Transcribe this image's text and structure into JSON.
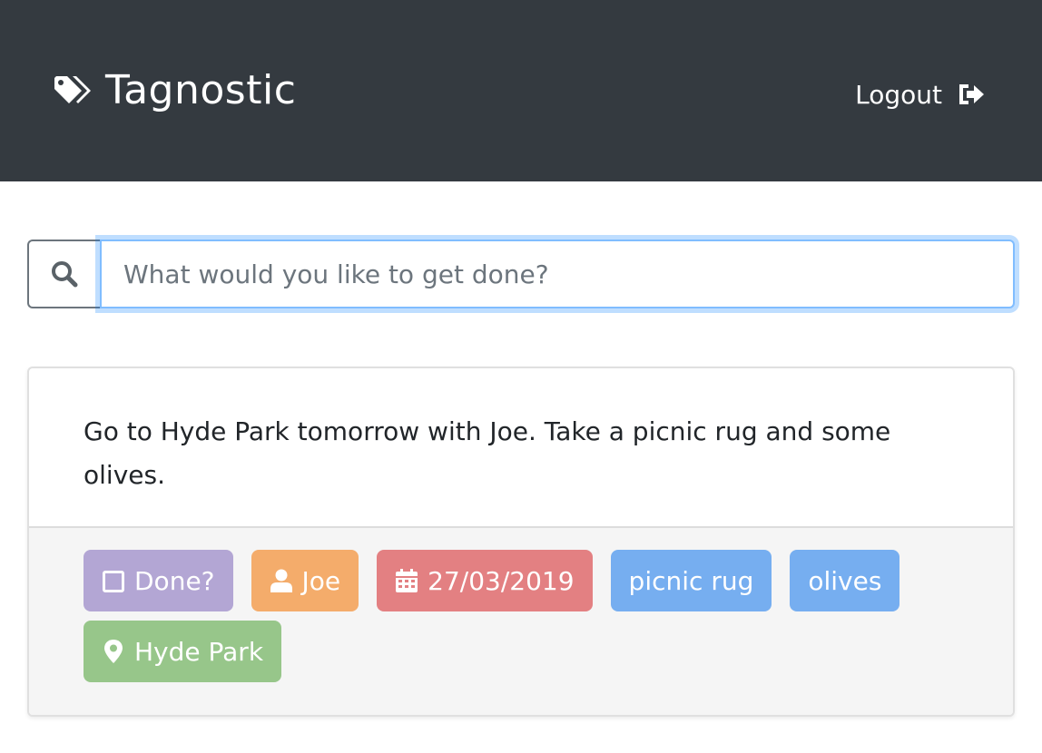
{
  "header": {
    "brand": "Tagnostic",
    "logout_label": "Logout",
    "background_color": "#343a40"
  },
  "search": {
    "placeholder": "What would you like to get done?",
    "value": ""
  },
  "task": {
    "text": "Go to Hyde Park tomorrow with Joe. Take a picnic rug and some olives.",
    "tags": {
      "done": {
        "label": "Done?",
        "icon": "checkbox-icon",
        "color": "#b3a6d4"
      },
      "person": {
        "label": "Joe",
        "icon": "user-icon",
        "color": "#f4ac6b"
      },
      "date": {
        "label": "27/03/2019",
        "icon": "calendar-icon",
        "color": "#e38082"
      },
      "thing1": {
        "label": "picnic rug",
        "color": "#76aef0"
      },
      "thing2": {
        "label": "olives",
        "color": "#76aef0"
      },
      "place": {
        "label": "Hyde Park",
        "icon": "map-marker-icon",
        "color": "#97c68a"
      }
    }
  }
}
